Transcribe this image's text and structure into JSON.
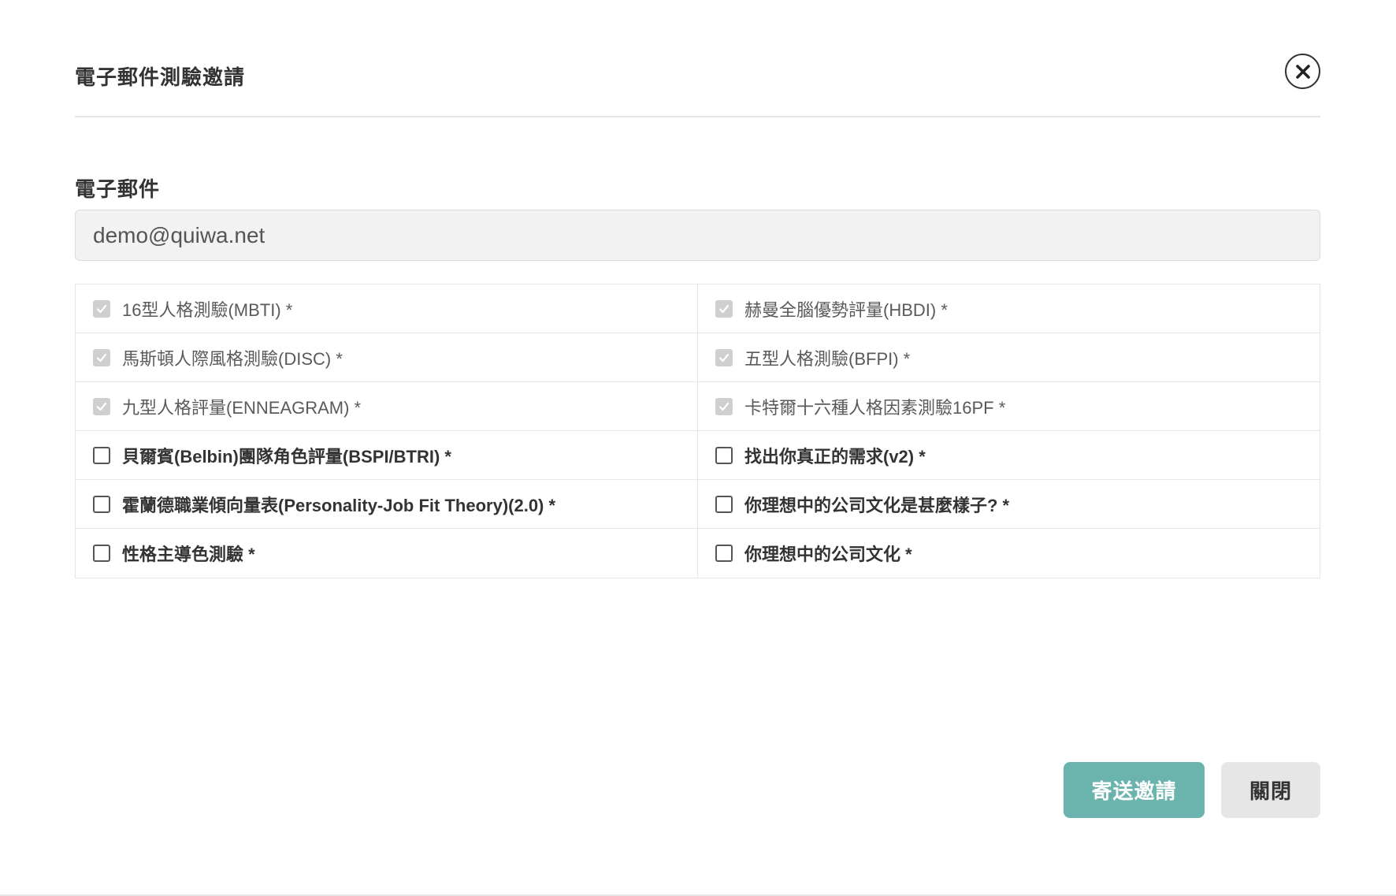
{
  "dialog": {
    "title": "電子郵件測驗邀請"
  },
  "email": {
    "label": "電子郵件",
    "value": "demo@quiwa.net"
  },
  "tests": [
    {
      "label": "16型人格測驗(MBTI) *",
      "checked": true,
      "disabled": true
    },
    {
      "label": "赫曼全腦優勢評量(HBDI) *",
      "checked": true,
      "disabled": true
    },
    {
      "label": "馬斯頓人際風格測驗(DISC) *",
      "checked": true,
      "disabled": true
    },
    {
      "label": "五型人格測驗(BFPI) *",
      "checked": true,
      "disabled": true
    },
    {
      "label": "九型人格評量(ENNEAGRAM) *",
      "checked": true,
      "disabled": true
    },
    {
      "label": "卡特爾十六種人格因素測驗16PF *",
      "checked": true,
      "disabled": true
    },
    {
      "label": "貝爾賓(Belbin)團隊角色評量(BSPI/BTRI) *",
      "checked": false,
      "disabled": false
    },
    {
      "label": "找出你真正的需求(v2) *",
      "checked": false,
      "disabled": false
    },
    {
      "label": "霍蘭德職業傾向量表(Personality-Job Fit Theory)(2.0) *",
      "checked": false,
      "disabled": false
    },
    {
      "label": "你理想中的公司文化是甚麼樣子? *",
      "checked": false,
      "disabled": false
    },
    {
      "label": "性格主導色測驗 *",
      "checked": false,
      "disabled": false
    },
    {
      "label": "你理想中的公司文化 *",
      "checked": false,
      "disabled": false
    }
  ],
  "footer": {
    "send_label": "寄送邀請",
    "close_label": "關閉"
  },
  "colors": {
    "primary": "#6bb3ad",
    "secondary": "#e6e6e6",
    "text": "#333333"
  }
}
